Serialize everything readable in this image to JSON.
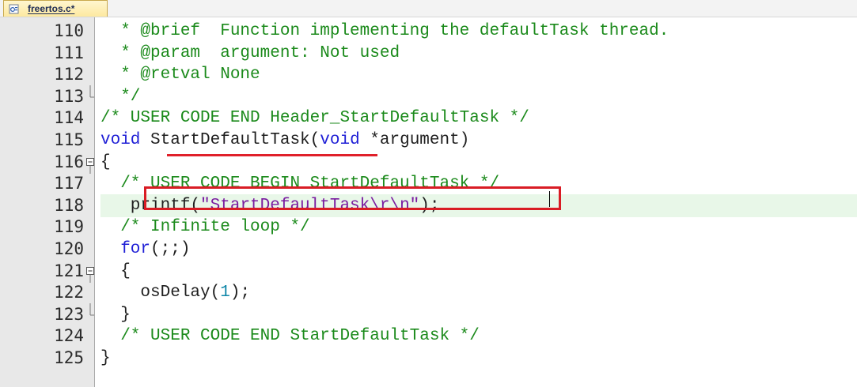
{
  "tab": {
    "label": "freertos.c*",
    "icon": "c-file-icon"
  },
  "lines": [
    {
      "num": "110",
      "parts": [
        {
          "cls": "cm",
          "t": "  * @brief  Function implementing the defaultTask thread."
        }
      ]
    },
    {
      "num": "111",
      "parts": [
        {
          "cls": "cm",
          "t": "  * @param  argument: Not used"
        }
      ]
    },
    {
      "num": "112",
      "parts": [
        {
          "cls": "cm",
          "t": "  * @retval None"
        }
      ]
    },
    {
      "num": "113",
      "parts": [
        {
          "cls": "cm",
          "t": "  */"
        }
      ]
    },
    {
      "num": "114",
      "parts": [
        {
          "cls": "cm",
          "t": "/* USER CODE END Header_StartDefaultTask */"
        }
      ]
    },
    {
      "num": "115",
      "parts": [
        {
          "cls": "kw",
          "t": "void"
        },
        {
          "cls": "tx",
          "t": " StartDefaultTask("
        },
        {
          "cls": "kw",
          "t": "void"
        },
        {
          "cls": "tx",
          "t": " *argument)"
        }
      ]
    },
    {
      "num": "116",
      "parts": [
        {
          "cls": "tx",
          "t": "{"
        }
      ]
    },
    {
      "num": "117",
      "parts": [
        {
          "cls": "cm",
          "t": "  /* USER CODE BEGIN StartDefaultTask */"
        }
      ]
    },
    {
      "num": "118",
      "parts": [
        {
          "cls": "tx",
          "t": "   printf("
        },
        {
          "cls": "str",
          "t": "\"StartDefaultTask\\r\\n\""
        },
        {
          "cls": "tx",
          "t": ");"
        }
      ]
    },
    {
      "num": "119",
      "parts": [
        {
          "cls": "cm",
          "t": "  /* Infinite loop */"
        }
      ]
    },
    {
      "num": "120",
      "parts": [
        {
          "cls": "kw",
          "t": "  for"
        },
        {
          "cls": "tx",
          "t": "(;;)"
        }
      ]
    },
    {
      "num": "121",
      "parts": [
        {
          "cls": "tx",
          "t": "  {"
        }
      ]
    },
    {
      "num": "122",
      "parts": [
        {
          "cls": "tx",
          "t": "    osDelay("
        },
        {
          "cls": "num",
          "t": "1"
        },
        {
          "cls": "tx",
          "t": ");"
        }
      ]
    },
    {
      "num": "123",
      "parts": [
        {
          "cls": "tx",
          "t": "  }"
        }
      ]
    },
    {
      "num": "124",
      "parts": [
        {
          "cls": "cm",
          "t": "  /* USER CODE END StartDefaultTask */"
        }
      ]
    },
    {
      "num": "125",
      "parts": [
        {
          "cls": "tx",
          "t": "}"
        }
      ]
    }
  ],
  "current_line": "118",
  "fold_markers": {
    "113": "fold-end",
    "116": "fold-minus",
    "121": "fold-minus",
    "123": "fold-end"
  },
  "colors": {
    "comment": "#1b8a1b",
    "keyword": "#1f1fd6",
    "string": "#7a1ca0",
    "number": "#0e86a8",
    "annotation": "#d91c24",
    "current_line": "#e8f7e8"
  }
}
